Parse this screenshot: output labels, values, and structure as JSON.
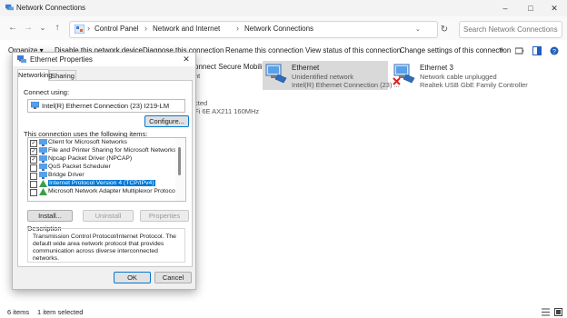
{
  "window": {
    "title": "Network Connections",
    "controls": {
      "minimize": "–",
      "maximize": "□",
      "close": "✕"
    }
  },
  "nav": {
    "back": "←",
    "forward": "→",
    "recent": "⌄",
    "up": "↑",
    "refresh": "↻",
    "dropdown": "⌄"
  },
  "breadcrumb": {
    "separator": "›",
    "items": [
      "Control Panel",
      "Network and Internet",
      "Network Connections"
    ]
  },
  "search": {
    "placeholder": "Search Network Connections"
  },
  "commands": {
    "organize": "Organize ▾",
    "disable": "Disable this network device",
    "diagnose": "Diagnose this connection",
    "rename": "Rename this connection",
    "view_status": "View status of this connection",
    "change_settings": "Change settings of this connection",
    "more": "»"
  },
  "connections": {
    "partial_vpn": "onnect Secure Mobility",
    "partial_vpn2": "nt",
    "partial_wifi": "cted",
    "partial_wifi2": "Fi 6E AX211 160MHz",
    "ethernet": {
      "name": "Ethernet",
      "status": "Unidentified network",
      "device": "Intel(R) Ethernet Connection (23) ..."
    },
    "ethernet3": {
      "name": "Ethernet 3",
      "status": "Network cable unplugged",
      "device": "Realtek USB GbE Family Controller"
    }
  },
  "statusbar": {
    "items": "6 items",
    "selected": "1 item selected"
  },
  "dialog": {
    "title": "Ethernet Properties",
    "close": "✕",
    "tabs": [
      "Networking",
      "Sharing"
    ],
    "connect_using_label": "Connect using:",
    "adapter": "Intel(R) Ethernet Connection (23) I219-LM",
    "configure": "Configure...",
    "items_label": "This connection uses the following items:",
    "items": [
      {
        "label": "Client for Microsoft Networks",
        "checked": "✓"
      },
      {
        "label": "File and Printer Sharing for Microsoft Networks",
        "checked": "✓"
      },
      {
        "label": "Npcap Packet Driver (NPCAP)",
        "checked": "✓"
      },
      {
        "label": "QoS Packet Scheduler",
        "checked": ""
      },
      {
        "label": "Bridge Driver",
        "checked": ""
      },
      {
        "label": "Internet Protocol Version 4 (TCP/IPv4)",
        "checked": ""
      },
      {
        "label": "Microsoft Network Adapter Multiplexor Protocol",
        "checked": ""
      }
    ],
    "install": "Install...",
    "uninstall": "Uninstall",
    "properties": "Properties",
    "description_label": "Description",
    "description": "Transmission Control Protocol/Internet Protocol. The default wide area network protocol that provides communication across diverse interconnected networks.",
    "ok": "OK",
    "cancel": "Cancel"
  },
  "colors": {
    "selection": "#0078d7",
    "accent": "#0078d4",
    "tile_selected": "#d9d9d9"
  }
}
